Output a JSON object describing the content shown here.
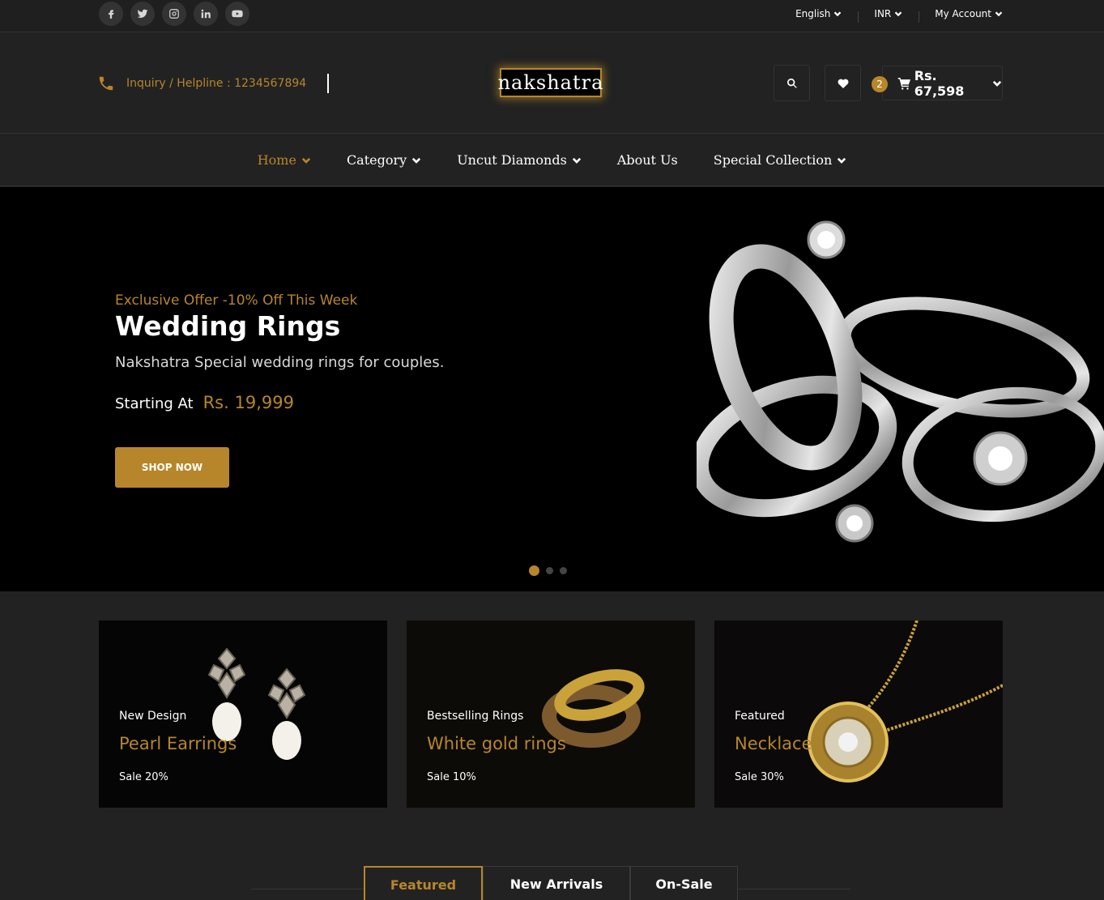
{
  "topbar": {
    "social": [
      {
        "icon": "facebook-icon"
      },
      {
        "icon": "twitter-icon"
      },
      {
        "icon": "instagram-icon"
      },
      {
        "icon": "linkedin-icon"
      },
      {
        "icon": "youtube-icon"
      }
    ],
    "language": "English",
    "currency": "INR",
    "account": "My Account"
  },
  "header": {
    "helpline": "Inquiry / Helpline : 1234567894",
    "logo_text": "nakshatra",
    "cart_count": "2",
    "cart_total": "Rs. 67,598"
  },
  "nav": {
    "items": [
      {
        "label": "Home",
        "active": true,
        "has_dropdown": true
      },
      {
        "label": "Category",
        "active": false,
        "has_dropdown": true
      },
      {
        "label": "Uncut Diamonds",
        "active": false,
        "has_dropdown": true
      },
      {
        "label": "About Us",
        "active": false,
        "has_dropdown": false
      },
      {
        "label": "Special Collection",
        "active": false,
        "has_dropdown": true
      }
    ]
  },
  "hero": {
    "offer": "Exclusive Offer -10% Off This Week",
    "title": "Wedding Rings",
    "subtitle": "Nakshatra Special wedding rings for couples.",
    "starting_label": "Starting At",
    "starting_price": "Rs. 19,999",
    "cta": "SHOP NOW",
    "slides": 3,
    "active_slide": 1
  },
  "banners": [
    {
      "tag": "New Design",
      "name": "Pearl Earrings",
      "sale": "Sale 20%"
    },
    {
      "tag": "Bestselling Rings",
      "name": "White gold rings",
      "sale": "Sale 10%"
    },
    {
      "tag": "Featured",
      "name": "Necklace",
      "sale": "Sale 30%"
    }
  ],
  "tabs": [
    {
      "label": "Featured",
      "active": true
    },
    {
      "label": "New Arrivals",
      "active": false
    },
    {
      "label": "On-Sale",
      "active": false
    }
  ],
  "colors": {
    "accent": "#b7862a",
    "background": "#222222",
    "hero_background": "#000000"
  }
}
